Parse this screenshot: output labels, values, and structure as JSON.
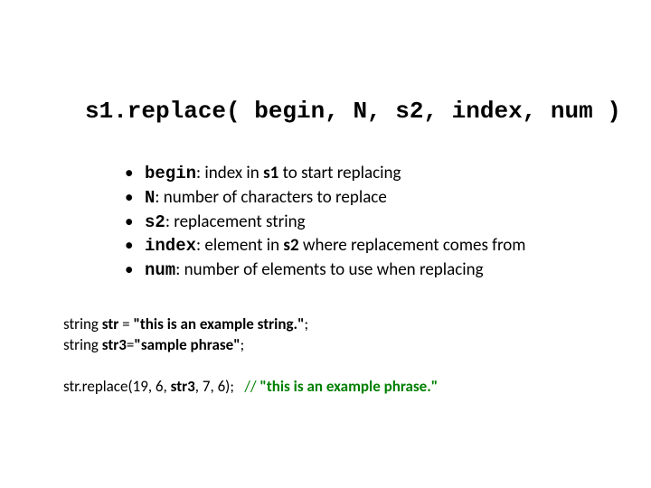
{
  "title": "s1.replace( begin, N, s2, index, num )",
  "bullets": {
    "begin": {
      "term": "begin",
      "desc_before": ": index in ",
      "s1": "s1",
      "desc_after": " to start replacing"
    },
    "N": {
      "term": "N",
      "desc": ": number of characters to replace"
    },
    "s2": {
      "term": "s2",
      "desc": ": replacement string"
    },
    "index": {
      "term": "index",
      "desc_before": ": element in ",
      "s2": "s2",
      "desc_after": " where replacement comes from"
    },
    "num": {
      "term": "num",
      "desc": ": number of elements to use when replacing"
    }
  },
  "code": {
    "l1_a": "string ",
    "l1_b": "str",
    "l1_c": " = ",
    "l1_d": "\"this is an example string.\"",
    "l1_e": ";",
    "l2_a": "string ",
    "l2_b": "str3",
    "l2_c": "=",
    "l2_d": "\"sample phrase\"",
    "l2_e": ";",
    "l3_a": "str.replace(19, 6, ",
    "l3_b": "str3",
    "l3_c": ", 7, 6);   ",
    "l3_comment_a": "// ",
    "l3_comment_b": "\"this is an example phrase.\""
  },
  "dot": "•"
}
